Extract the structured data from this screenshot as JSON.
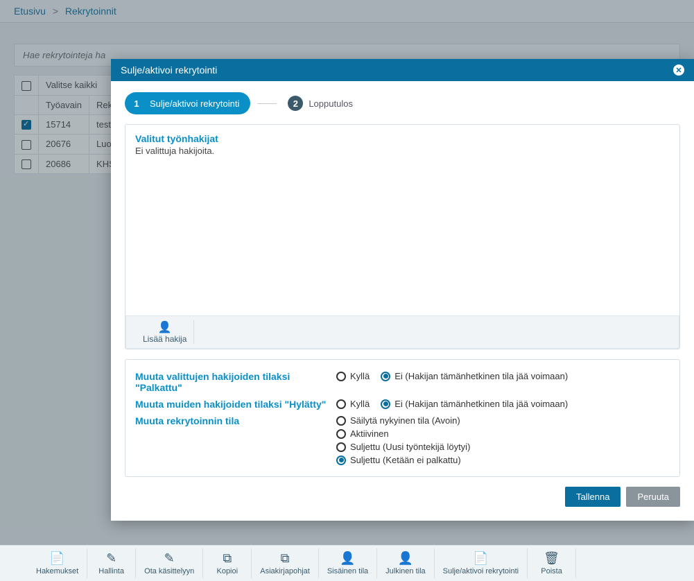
{
  "breadcrumb": {
    "home": "Etusivu",
    "current": "Rekrytoinnit"
  },
  "search": {
    "placeholder": "Hae rekrytointeja ha"
  },
  "table": {
    "select_all": "Valitse kaikki",
    "cols": {
      "tyoavain": "Työavain",
      "rekr": "Rekr"
    },
    "rows": [
      {
        "checked": true,
        "tyoavain": "15714",
        "rekr": "test"
      },
      {
        "checked": false,
        "tyoavain": "20676",
        "rekr": "Luok"
      },
      {
        "checked": false,
        "tyoavain": "20686",
        "rekr": "KHS"
      }
    ]
  },
  "modal": {
    "title": "Sulje/aktivoi rekrytointi",
    "steps": {
      "s1": "Sulje/aktivoi rekrytointi",
      "s2": "Lopputulos"
    },
    "applicants": {
      "heading": "Valitut työnhakijat",
      "empty": "Ei valittuja hakijoita.",
      "add": "Lisää hakija"
    },
    "form": {
      "row1_label": "Muuta valittujen hakijoiden tilaksi \"Palkattu\"",
      "row2_label": "Muuta muiden hakijoiden tilaksi \"Hylätty\"",
      "row3_label": "Muuta rekrytoinnin tila",
      "yes": "Kyllä",
      "no": "Ei (Hakijan tämänhetkinen tila jää voimaan)",
      "status_options": {
        "keep": "Säilytä nykyinen tila (Avoin)",
        "active": "Aktiivinen",
        "closed_found": "Suljettu (Uusi työntekijä löytyi)",
        "closed_none": "Suljettu (Ketään ei palkattu)"
      }
    },
    "actions": {
      "save": "Tallenna",
      "cancel": "Peruuta"
    }
  },
  "toolbar": {
    "hakemukset": "Hakemukset",
    "hallinta": "Hallinta",
    "ota": "Ota käsittelyyn",
    "kopioi": "Kopioi",
    "asiakirja": "Asiakirjapohjat",
    "sisainen": "Sisäinen tila",
    "julkinen": "Julkinen tila",
    "sulje": "Sulje/aktivoi rekrytointi",
    "poista": "Poista"
  }
}
